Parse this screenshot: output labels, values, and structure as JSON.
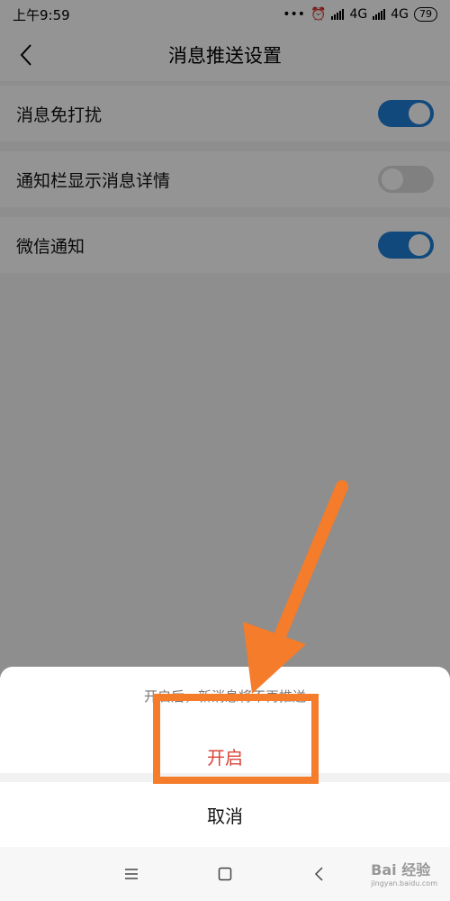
{
  "status_bar": {
    "time": "上午9:59",
    "network_1": "4G",
    "network_2": "4G",
    "battery": "79"
  },
  "header": {
    "title": "消息推送设置",
    "back_icon": "chevron-left-icon"
  },
  "settings": [
    {
      "label": "消息免打扰",
      "enabled": true
    },
    {
      "label": "通知栏显示消息详情",
      "enabled": false
    },
    {
      "label": "微信通知",
      "enabled": true
    }
  ],
  "sheet": {
    "message": "开启后，新消息将不再推送",
    "confirm_label": "开启",
    "cancel_label": "取消"
  },
  "nav_bar": {
    "menu_icon": "menu-icon",
    "home_icon": "home-icon",
    "back_icon": "back-icon"
  },
  "watermark": {
    "text": "Bai 经验",
    "sub": "jingyan.baidu.com"
  },
  "colors": {
    "toggle_on": "#1e7fd6",
    "confirm_red": "#d9453a",
    "annotation_orange": "#f47c2a"
  }
}
